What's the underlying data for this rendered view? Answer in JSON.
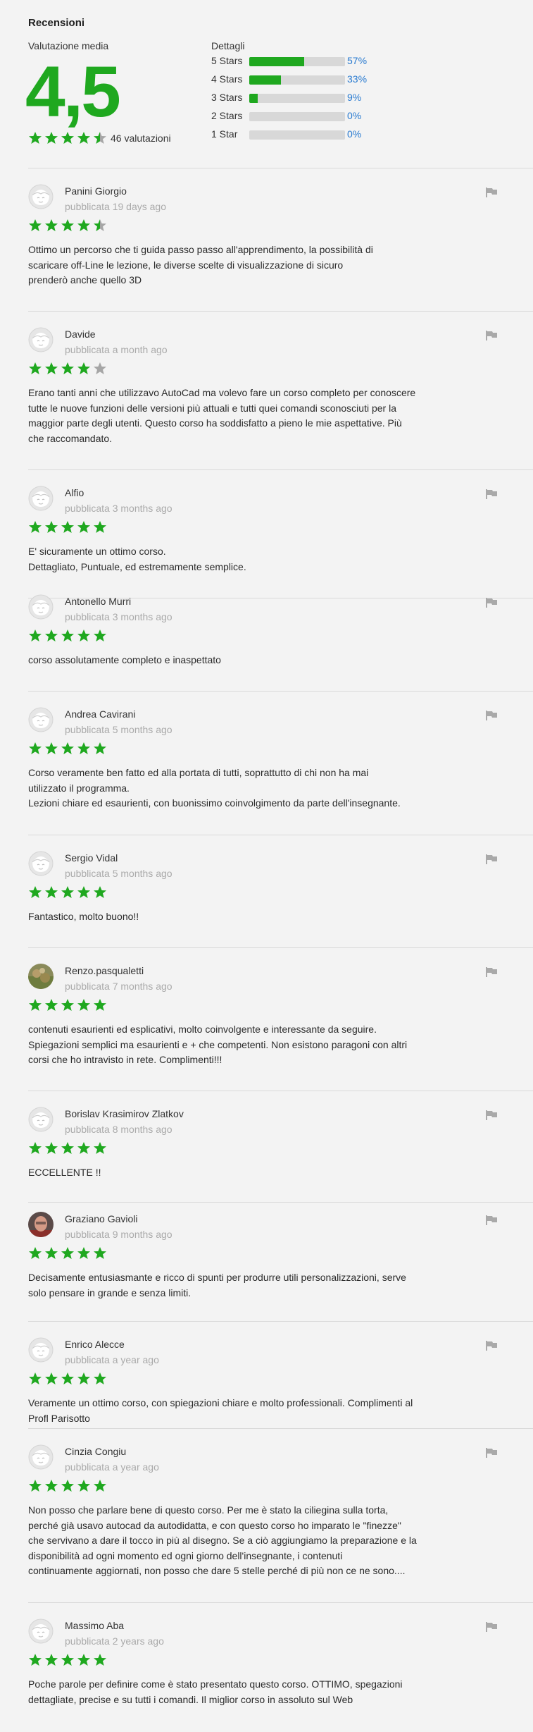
{
  "summary": {
    "title": "Recensioni",
    "avg_label": "Valutazione media",
    "avg_value": "4,5",
    "rating": 4.5,
    "count_text": "46 valutazioni",
    "details_label": "Dettagli",
    "bars": [
      {
        "label": "5 Stars",
        "pct_text": "57%",
        "pct": 57
      },
      {
        "label": "4 Stars",
        "pct_text": "33%",
        "pct": 33
      },
      {
        "label": "3 Stars",
        "pct_text": "9%",
        "pct": 9
      },
      {
        "label": "2 Stars",
        "pct_text": "0%",
        "pct": 0
      },
      {
        "label": "1 Star",
        "pct_text": "0%",
        "pct": 0
      }
    ]
  },
  "colors": {
    "star_on": "#1fa81f",
    "star_off": "#a6a6a6",
    "accent_link": "#2a7bd0",
    "bar_track": "#d8d8d8"
  },
  "reviews": [
    {
      "author": "Panini Giorgio",
      "date": "pubblicata 19 days ago",
      "rating": 4.5,
      "avatar": "default-avatar-icon",
      "lines": [
        "Ottimo un percorso che ti guida passo passo all'apprendimento, la possibilità di",
        "scaricare off-Line le lezione, le diverse scelte di visualizzazione di sicuro",
        "prenderò anche quello 3D"
      ]
    },
    {
      "author": "Davide",
      "date": "pubblicata a month ago",
      "rating": 4,
      "avatar": "default-avatar-icon",
      "lines": [
        "Erano tanti anni che utilizzavo AutoCad ma volevo fare un corso completo per conoscere",
        "tutte le nuove funzioni delle versioni più attuali e tutti quei comandi sconosciuti per la",
        "maggior parte degli utenti. Questo corso ha soddisfatto a pieno le mie aspettative. Più",
        "che raccomandato."
      ]
    },
    {
      "author": "Alfio",
      "date": "pubblicata 3 months ago",
      "rating": 5,
      "avatar": "default-avatar-icon",
      "lines": [
        "E' sicuramente un ottimo corso.",
        "Dettagliato, Puntuale, ed estremamente semplice."
      ]
    },
    {
      "author": "Antonello Murri",
      "date": "pubblicata 3 months ago",
      "rating": 5,
      "avatar": "default-avatar-icon",
      "lines": [
        "corso assolutamente completo e inaspettato"
      ]
    },
    {
      "author": "Andrea Cavirani",
      "date": "pubblicata 5 months ago",
      "rating": 5,
      "avatar": "default-avatar-icon",
      "lines": [
        "Corso veramente ben fatto ed alla portata di tutti, soprattutto di chi non ha mai",
        "utilizzato il programma.",
        "Lezioni chiare ed esaurienti, con buonissimo coinvolgimento da parte dell'insegnante."
      ]
    },
    {
      "author": "Sergio Vidal",
      "date": "pubblicata 5 months ago",
      "rating": 5,
      "avatar": "default-avatar-icon",
      "lines": [
        "Fantastico, molto buono!!"
      ]
    },
    {
      "author": "Renzo.pasqualetti",
      "date": "pubblicata 7 months ago",
      "rating": 5,
      "avatar": "photo-avatar-landscape",
      "lines": [
        "contenuti esaurienti ed esplicativi, molto coinvolgente e interessante da seguire.",
        "Spiegazioni semplici ma esaurienti e + che competenti. Non esistono paragoni con altri",
        "corsi che ho intravisto in rete. Complimenti!!!"
      ]
    },
    {
      "author": "Borislav Krasimirov Zlatkov",
      "date": "pubblicata 8 months ago",
      "rating": 5,
      "avatar": "default-avatar-icon",
      "lines": [
        "ECCELLENTE !!"
      ]
    },
    {
      "author": "Graziano Gavioli",
      "date": "pubblicata 9 months ago",
      "rating": 5,
      "avatar": "photo-avatar-person",
      "lines": [
        "Decisamente entusiasmante e ricco di spunti per produrre utili personalizzazioni, serve",
        "solo pensare in grande e senza limiti."
      ]
    },
    {
      "author": "Enrico Alecce",
      "date": "pubblicata a year ago",
      "rating": 5,
      "avatar": "default-avatar-icon",
      "lines": [
        "Veramente un ottimo corso, con spiegazioni chiare e molto professionali. Complimenti al",
        "Profl Parisotto"
      ]
    },
    {
      "author": "Cinzia Congiu",
      "date": "pubblicata a year ago",
      "rating": 5,
      "avatar": "default-avatar-icon",
      "lines": [
        "Non posso che parlare bene di questo corso. Per me è stato la ciliegina sulla torta,",
        "perché già usavo autocad da autodidatta, e con questo corso ho imparato le \"finezze\"",
        "che servivano a dare il tocco in più al disegno. Se a ciò aggiungiamo la preparazione e la",
        "disponibilità ad ogni momento ed ogni giorno dell'insegnante, i contenuti",
        "continuamente aggiornati, non posso che dare 5 stelle perché di più non ce ne sono...."
      ]
    },
    {
      "author": "Massimo Aba",
      "date": "pubblicata 2 years ago",
      "rating": 5,
      "avatar": "default-avatar-icon",
      "lines": [
        "Poche parole per definire come è stato presentato questo corso. OTTIMO, spegazioni",
        "dettagliate, precise e su tutti i comandi. Il miglior corso in assoluto sul Web"
      ]
    }
  ]
}
